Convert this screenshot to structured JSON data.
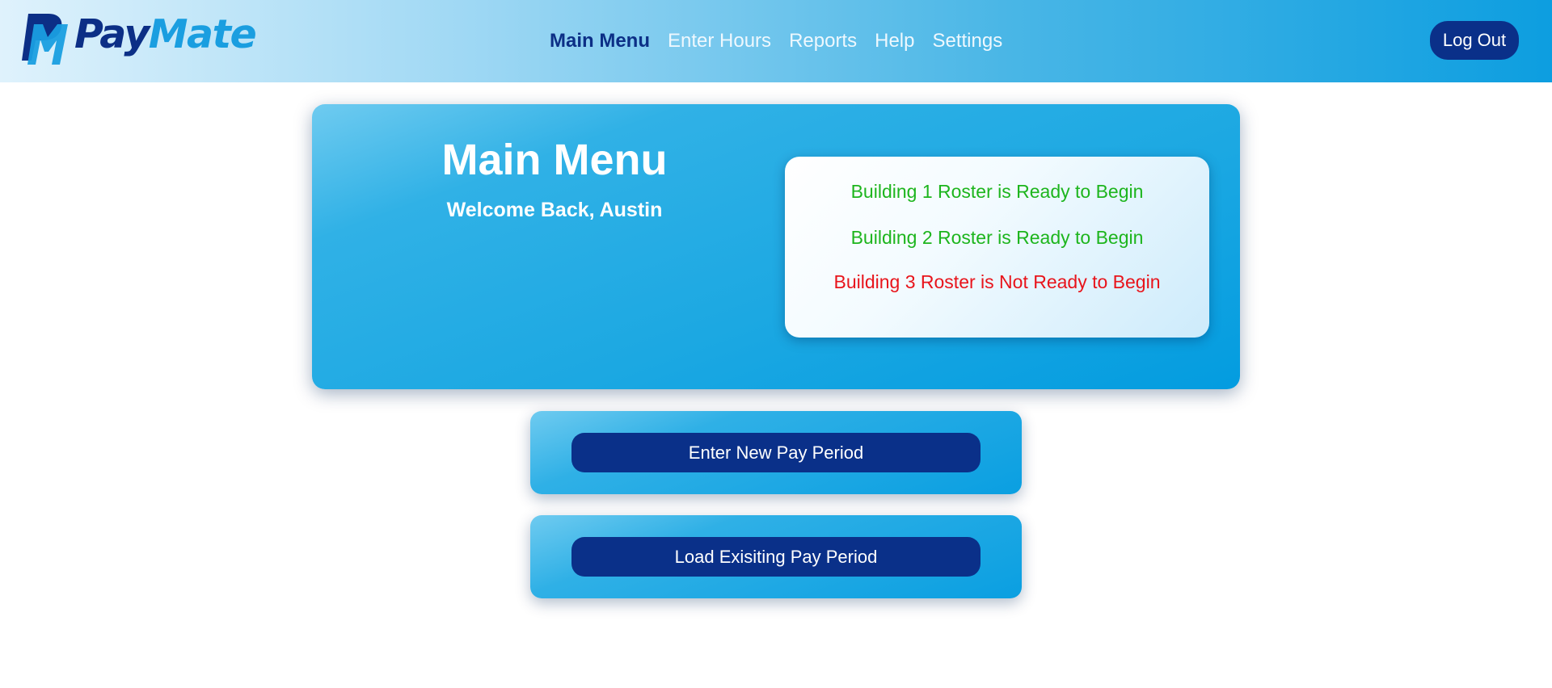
{
  "brand": {
    "name_part1": "Pay",
    "name_part2": "Mate",
    "logo_icon": "pm-monogram-icon",
    "colors": {
      "dark": "#0c2f86",
      "light": "#1a9ee0"
    }
  },
  "nav": {
    "items": [
      {
        "label": "Main Menu",
        "active": true
      },
      {
        "label": "Enter Hours",
        "active": false
      },
      {
        "label": "Reports",
        "active": false
      },
      {
        "label": "Help",
        "active": false
      },
      {
        "label": "Settings",
        "active": false
      }
    ]
  },
  "header": {
    "logout_label": "Log Out"
  },
  "main": {
    "title": "Main Menu",
    "welcome": "Welcome Back, Austin",
    "status": [
      {
        "text": "Building 1 Roster is Ready to Begin",
        "state": "ready",
        "color": "#1db51d"
      },
      {
        "text": "Building 2 Roster is Ready to Begin",
        "state": "ready",
        "color": "#1db51d"
      },
      {
        "text": "Building 3 Roster is Not Ready to Begin",
        "state": "not-ready",
        "color": "#e8141b"
      }
    ]
  },
  "actions": {
    "new_pay_period": "Enter New Pay Period",
    "load_pay_period": "Load Exisiting Pay Period"
  },
  "theme": {
    "navy": "#0a3089",
    "accent": "#1ca8e2"
  }
}
